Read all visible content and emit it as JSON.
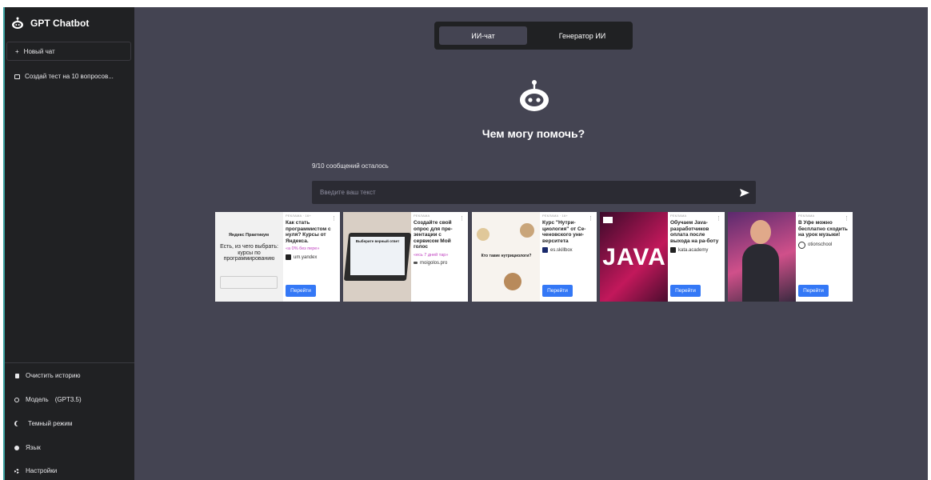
{
  "sidebar": {
    "app_name": "GPT Chatbot",
    "new_chat": "Новый чат",
    "history": [
      "Создай тест на 10 вопросов..."
    ],
    "options": {
      "clear": "Очистить историю",
      "model": "Модель",
      "model_value": "(GPT3.5)",
      "dark": "Темный режим",
      "language": "Язык",
      "settings": "Настройки"
    }
  },
  "tabs": [
    "ИИ-чат",
    "Генератор ИИ"
  ],
  "headline": "Чем могу помочь?",
  "counter": "9/10 сообщений осталось",
  "input": {
    "placeholder": "Введите ваш текст",
    "value": ""
  },
  "ads": [
    {
      "label": "РЕКЛАМА · 16+",
      "title": "Как стать программистом с нуля? Курсы от Яндекса.",
      "extra": "«а 0% без пере»",
      "source": "um.yandex",
      "button": "Перейти",
      "image_text": "Яндекс Практикум\nЕсть, из чего выбрать: курсы по программированию"
    },
    {
      "label": "РЕКЛАМА",
      "title": "Создайте свой опрос для пре-зентации с сервисом Мой голос",
      "extra": "«есь 7 дней тар»",
      "source": "moigolos.pro",
      "button": "Перейти",
      "image_text": "Выберите верный ответ"
    },
    {
      "label": "РЕКЛАМА · 16+",
      "title": "Курс \"Нутри-циология\" от Се-ченовского уни-верситета",
      "extra": "",
      "source": "es.skillbox",
      "button": "Перейти",
      "image_text": "Кто такие нутрициологи?"
    },
    {
      "label": "РЕКЛАМА",
      "title": "Обучаем Java-разработчиков оплата после выхода на ра-боту",
      "extra": "",
      "source": "kata.academy",
      "button": "Перейти",
      "image_text": "JAVA"
    },
    {
      "label": "РЕКЛАМА",
      "title": "В Уфе можно бесплатно сходить на урок музыки!",
      "extra": "",
      "source": "otionschool",
      "button": "Перейти",
      "image_text": ""
    }
  ],
  "colors": {
    "sidebar": "#202123",
    "main": "#444452",
    "accent": "#3478f6"
  }
}
